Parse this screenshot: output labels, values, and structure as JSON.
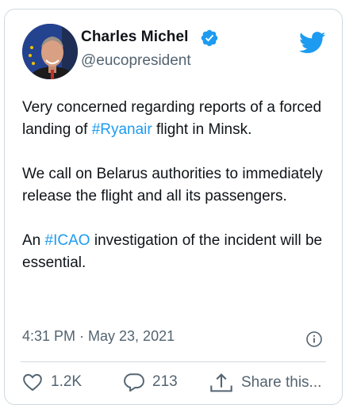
{
  "user": {
    "name": "Charles Michel",
    "handle": "@eucopresident"
  },
  "tweet": {
    "p1_pre": "Very concerned regarding reports of a forced landing of ",
    "p1_tag": "#Ryanair",
    "p1_post": " flight in Minsk.",
    "p2": "We call on Belarus authorities to immediately release the flight and all its passengers.",
    "p3_pre": "An ",
    "p3_tag": "#ICAO",
    "p3_post": " investigation of the incident will be essential.",
    "timestamp": "4:31 PM · May 23, 2021"
  },
  "actions": {
    "likes": "1.2K",
    "replies": "213",
    "share_label": "Share this..."
  },
  "colors": {
    "link": "#1d9bf0",
    "muted": "#536471",
    "border": "#cfd9de"
  },
  "icons": [
    "verified-badge-icon",
    "twitter-bird-icon",
    "info-icon",
    "heart-icon",
    "reply-icon",
    "share-icon"
  ]
}
